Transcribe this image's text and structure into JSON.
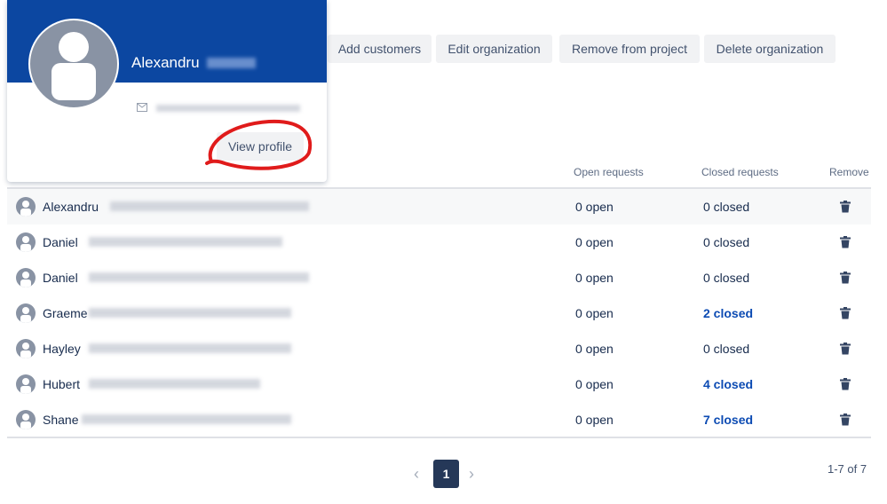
{
  "toolbar": {
    "add": "Add customers",
    "edit": "Edit organization",
    "remove": "Remove from project",
    "delete": "Delete organization"
  },
  "popup": {
    "first_name": "Alexandru",
    "view_profile": "View profile"
  },
  "table": {
    "headers": {
      "open": "Open requests",
      "closed": "Closed requests",
      "remove": "Remove"
    },
    "rows": [
      {
        "name": "Alexandru",
        "open": "0 open",
        "closed": "0 closed",
        "link": false
      },
      {
        "name": "Daniel",
        "open": "0 open",
        "closed": "0 closed",
        "link": false
      },
      {
        "name": "Daniel",
        "open": "0 open",
        "closed": "0 closed",
        "link": false
      },
      {
        "name": "Graeme",
        "open": "0 open",
        "closed": "2 closed",
        "link": true
      },
      {
        "name": "Hayley",
        "open": "0 open",
        "closed": "0 closed",
        "link": false
      },
      {
        "name": "Hubert",
        "open": "0 open",
        "closed": "4 closed",
        "link": true
      },
      {
        "name": "Shane",
        "open": "0 open",
        "closed": "7 closed",
        "link": true
      }
    ]
  },
  "pagination": {
    "current": "1",
    "summary": "1-7 of 7"
  },
  "colors": {
    "brand": "#0c47a1",
    "link": "#0c4bb3",
    "annotation": "#e01b1b"
  }
}
